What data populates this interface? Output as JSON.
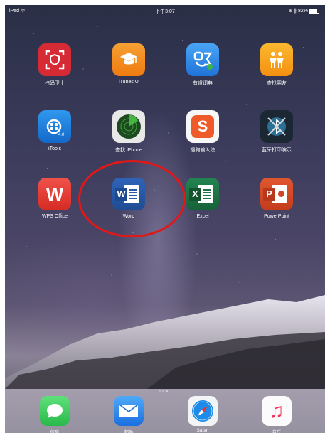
{
  "status_bar": {
    "left": "iPad ᯤ",
    "time": "下午3:07",
    "right": "⊕ ∦ 82%"
  },
  "apps": [
    {
      "name": "扫码卫士",
      "icon": "scan-guard-icon",
      "color": "#d62b35"
    },
    {
      "name": "iTunes U",
      "icon": "itunes-u-icon",
      "color": "#f28a1b"
    },
    {
      "name": "有道词典",
      "icon": "youdao-dictionary-icon",
      "color": "#2f8ae5"
    },
    {
      "name": "查找朋友",
      "icon": "find-friends-icon",
      "color": "#f7a21a"
    },
    {
      "name": "iTools",
      "icon": "itools-icon",
      "color": "#1c7fdc"
    },
    {
      "name": "查找 iPhone",
      "icon": "find-iphone-icon",
      "color": "#1e3d21"
    },
    {
      "name": "搜狗输入法",
      "icon": "sogou-input-icon",
      "color": "#ef5a2a"
    },
    {
      "name": "蓝牙打印演示",
      "icon": "bluetooth-print-icon",
      "color": "#1b2733"
    },
    {
      "name": "WPS Office",
      "icon": "wps-office-icon",
      "color": "#e23b32"
    },
    {
      "name": "Word",
      "icon": "word-icon",
      "color": "#2b5aa8"
    },
    {
      "name": "Excel",
      "icon": "excel-icon",
      "color": "#1e7346"
    },
    {
      "name": "PowerPoint",
      "icon": "powerpoint-icon",
      "color": "#d04526"
    }
  ],
  "dock": [
    {
      "name": "信息",
      "icon": "messages-icon",
      "color": "#3ec95a"
    },
    {
      "name": "邮件",
      "icon": "mail-icon",
      "color": "#2b8cf1"
    },
    {
      "name": "Safari",
      "icon": "safari-icon",
      "color": "#f3f4f6"
    },
    {
      "name": "音乐",
      "icon": "music-icon",
      "color": "#fbfbfb"
    }
  ],
  "glyphs": {
    "word": "W",
    "excel": "X",
    "ppt": "P",
    "wps": "W",
    "sogou": "S",
    "music": "♫"
  }
}
